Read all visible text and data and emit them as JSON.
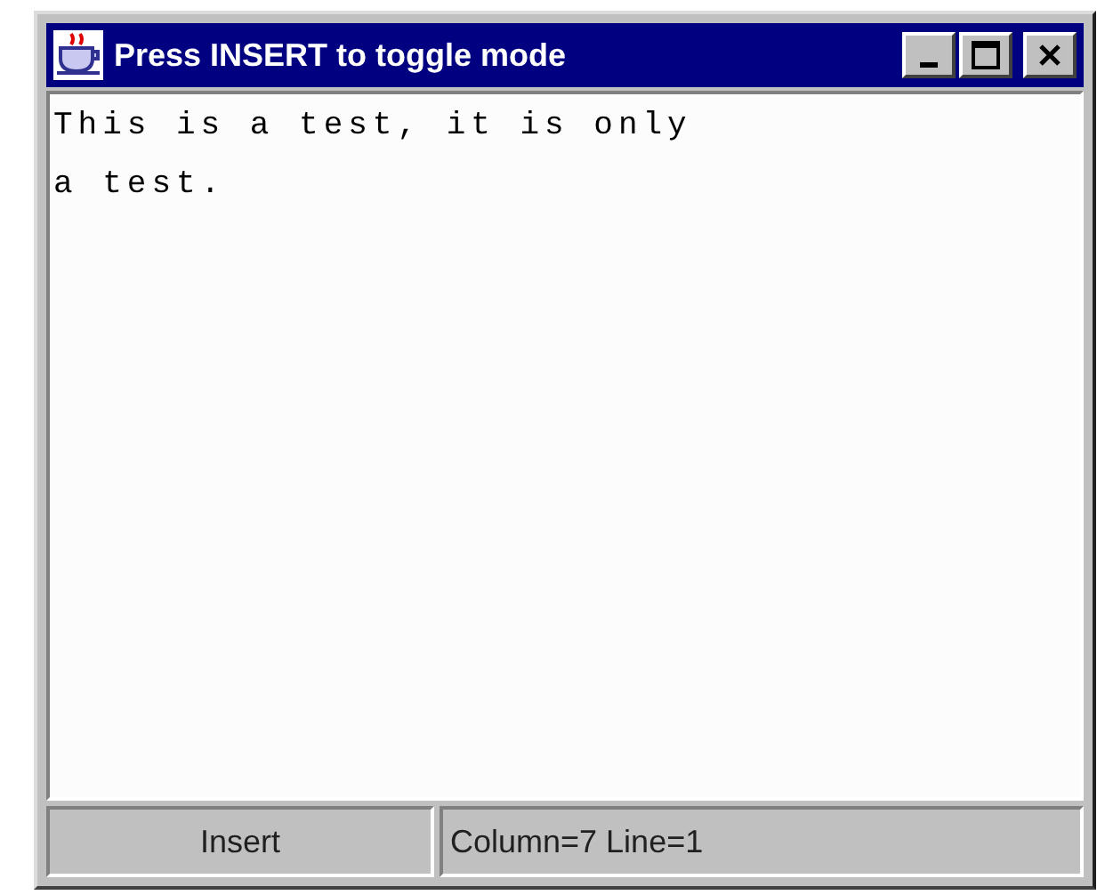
{
  "window": {
    "title": "Press INSERT to toggle mode"
  },
  "editor": {
    "lines": [
      "This is a test, it is only",
      "a test."
    ]
  },
  "status_bar": {
    "mode": "Insert",
    "position": "Column=7 Line=1"
  }
}
